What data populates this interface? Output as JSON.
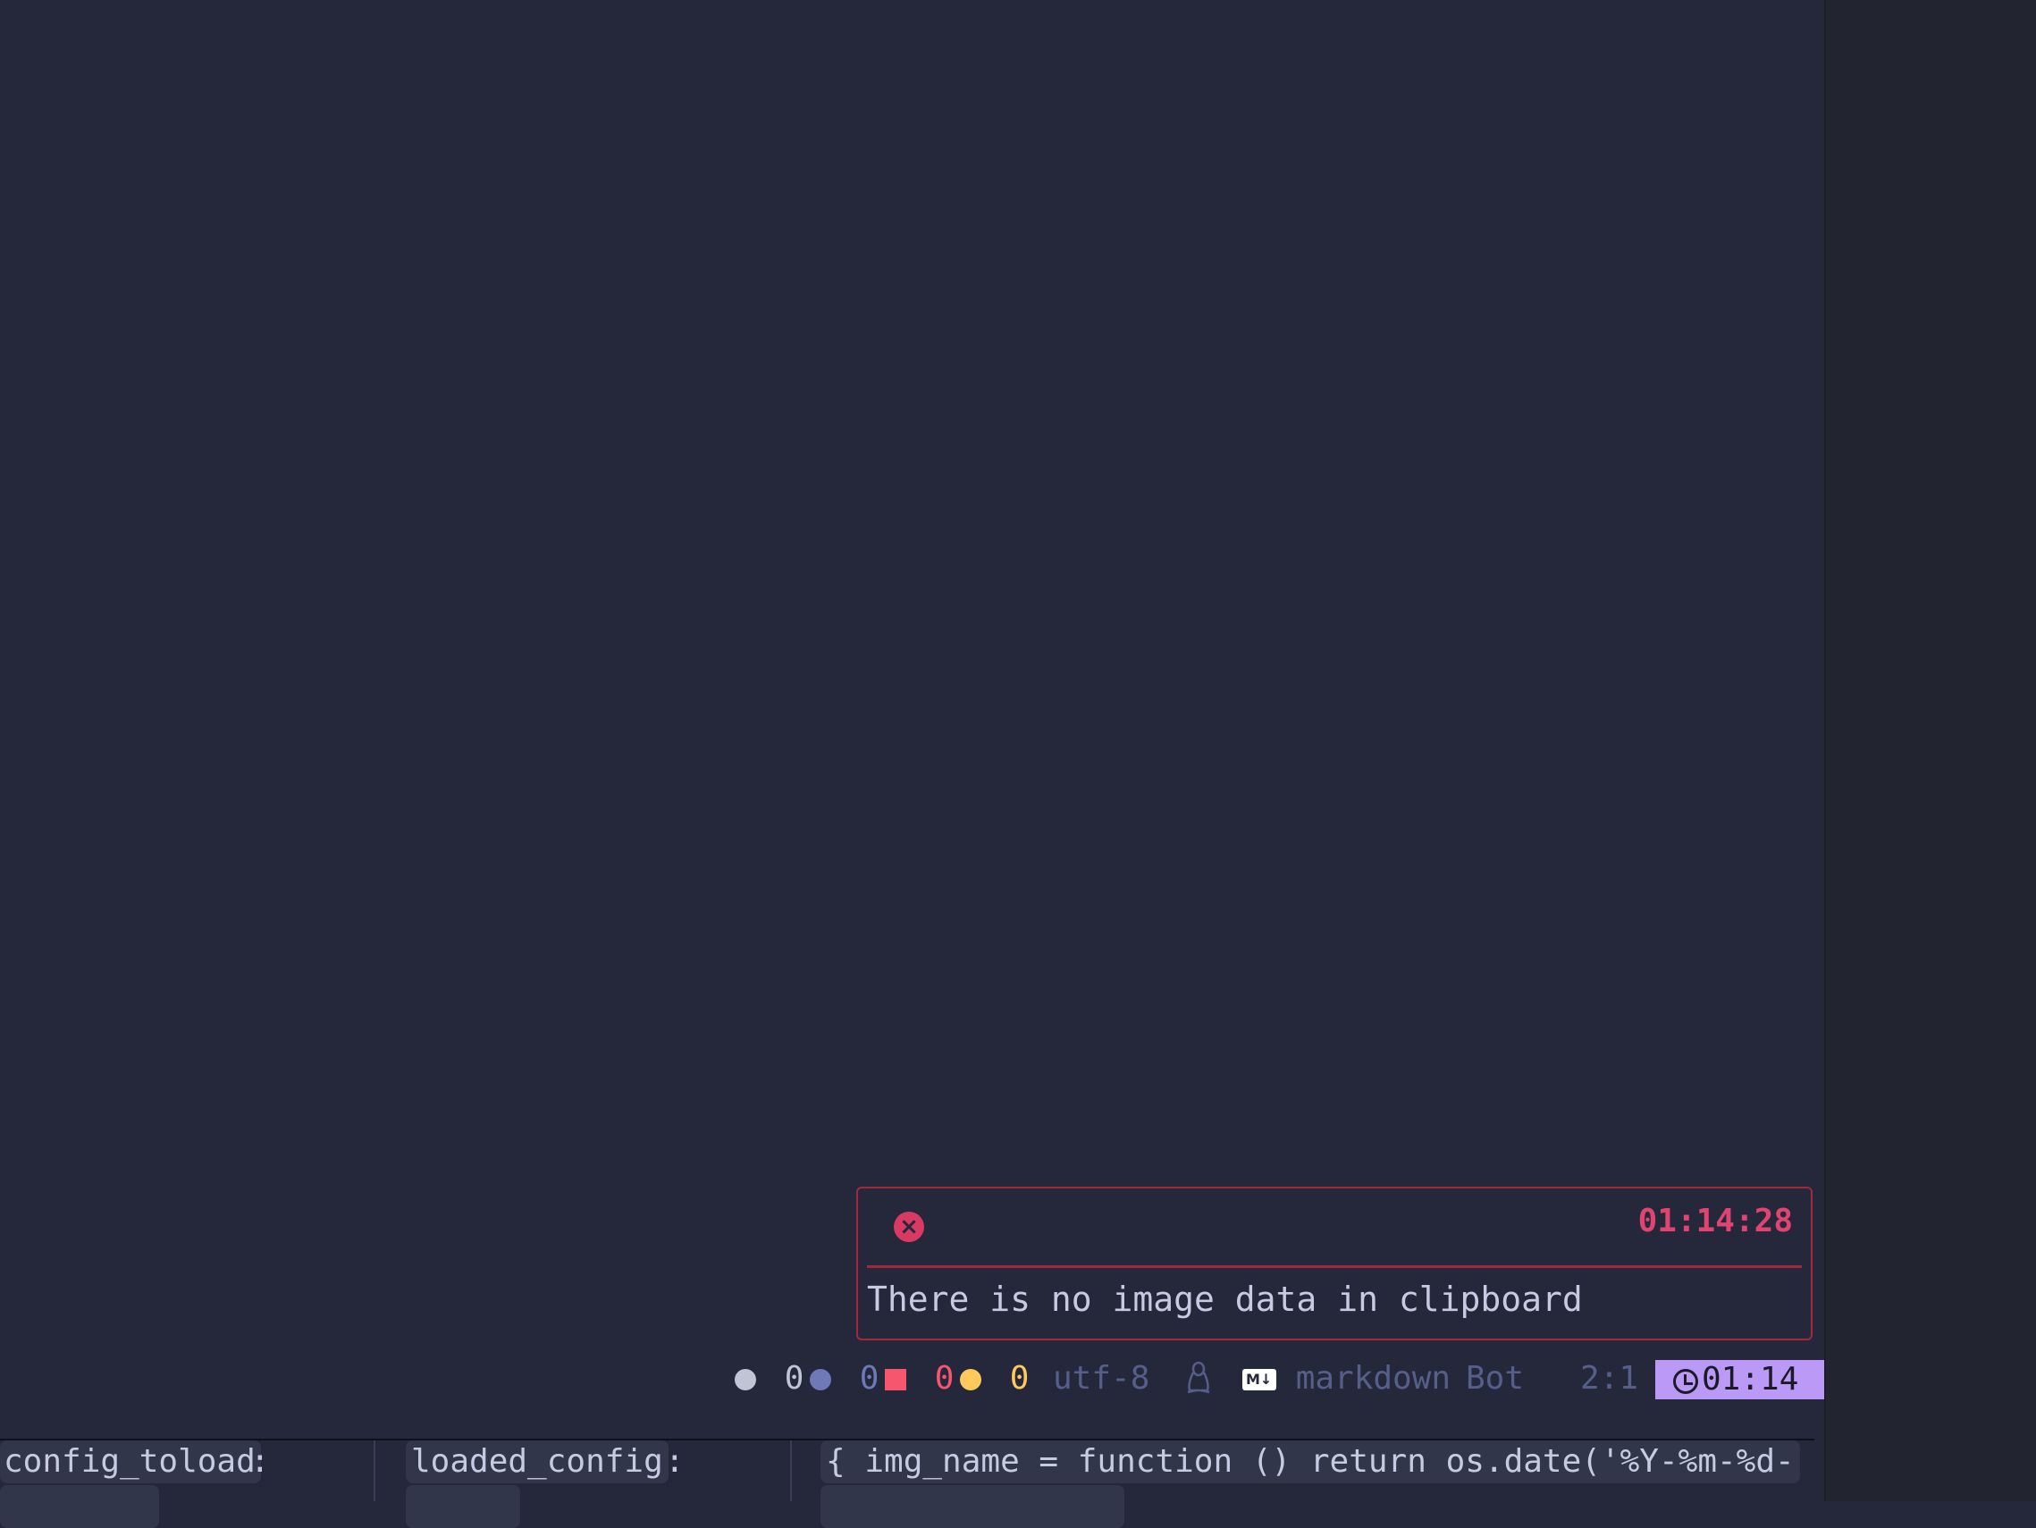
{
  "notification": {
    "time": "01:14:28",
    "message": "There is no image data in clipboard",
    "icon": "error-icon"
  },
  "statusline": {
    "diag_info_count": "0",
    "diag_hint_count": "0",
    "diag_error_count": "0",
    "diag_warn_count": "0",
    "encoding": "utf-8",
    "os_icon": "linux-penguin-icon",
    "filetype": "markdown",
    "position_label": "Bot",
    "cursor": "2:1",
    "clock": "01:14",
    "colors": {
      "info": "#c0c4d4",
      "hint": "#7079b8",
      "error": "#f7566f",
      "warn": "#ffc95c",
      "muted": "#565f89",
      "clock_bg": "#bb9af7"
    }
  },
  "bottom_bar": {
    "col1_key": "config_toload",
    "col1_sep": ":",
    "col2_key": "loaded_config",
    "col2_sep": ":",
    "col3_value": "{ img_name = function () return os.date('%Y-%m-%d-"
  }
}
